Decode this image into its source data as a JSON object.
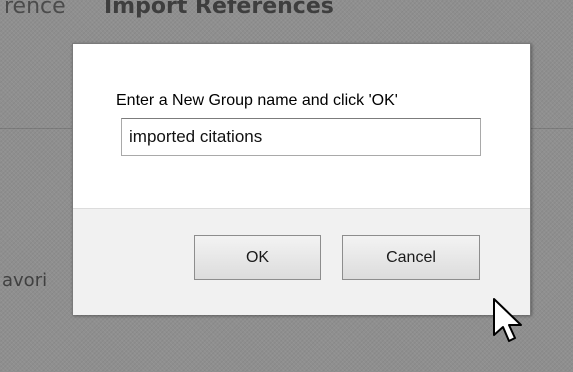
{
  "background": {
    "tabs": [
      {
        "label": "rence"
      },
      {
        "label": "Import References"
      }
    ],
    "side_text": "avori"
  },
  "dialog": {
    "prompt": "Enter a New Group name and click 'OK'",
    "input": {
      "value": "imported citations"
    },
    "buttons": {
      "ok": "OK",
      "cancel": "Cancel"
    }
  },
  "pointer": {
    "icon": "arrow-cursor-icon"
  }
}
